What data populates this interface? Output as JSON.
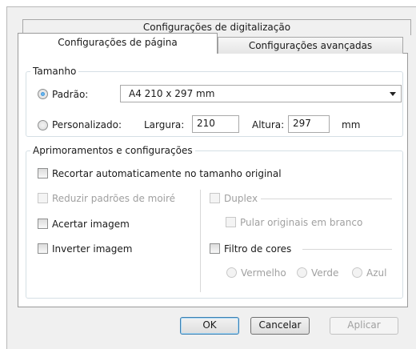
{
  "tabs": {
    "top": "Configurações de digitalização",
    "active": "Configurações de página",
    "inactive": "Configurações avançadas"
  },
  "size_group": {
    "legend": "Tamanho",
    "standard_label": "Padrão:",
    "standard_selected": true,
    "paper_size": "A4 210 x 297 mm",
    "custom_label": "Personalizado:",
    "custom_selected": false,
    "width_label": "Largura:",
    "width_value": "210",
    "height_label": "Altura:",
    "height_value": "297",
    "unit": "mm"
  },
  "enhancements": {
    "legend": "Aprimoramentos e configurações",
    "auto_crop": "Recortar automaticamente no tamanho original",
    "reduce_moire": "Reduzir padrões de moiré",
    "duplex": "Duplex",
    "skip_blank": "Pular originais em branco",
    "straighten": "Acertar imagem",
    "invert": "Inverter imagem",
    "color_filter": "Filtro de cores",
    "red": "Vermelho",
    "green": "Verde",
    "blue": "Azul"
  },
  "buttons": {
    "ok": "OK",
    "cancel": "Cancelar",
    "apply": "Aplicar"
  }
}
